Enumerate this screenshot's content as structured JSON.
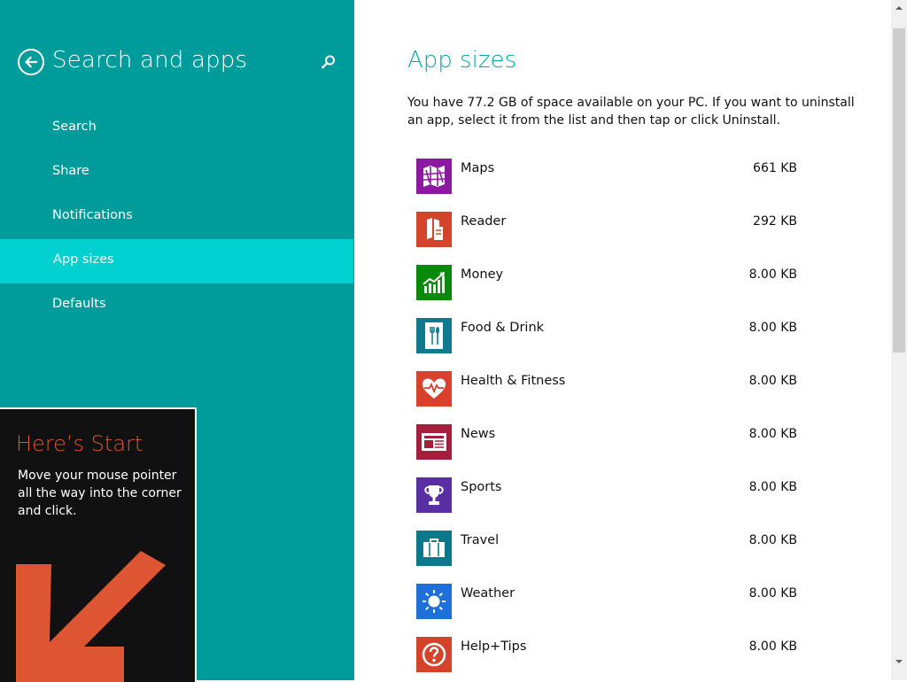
{
  "nav": {
    "title": "Search and apps",
    "back_icon": "back-arrow-icon",
    "search_icon": "search-icon",
    "items": [
      {
        "label": "Search",
        "active": false
      },
      {
        "label": "Share",
        "active": false
      },
      {
        "label": "Notifications",
        "active": false
      },
      {
        "label": "App sizes",
        "active": true
      },
      {
        "label": "Defaults",
        "active": false
      }
    ]
  },
  "start_tip": {
    "title": "Here’s Start",
    "body": "Move your mouse pointer all the way into the corner and click.",
    "icon": "corner-arrow-icon"
  },
  "main": {
    "title": "App sizes",
    "description": "You have 77.2 GB of space available on your PC. If you want to uninstall an app, select it from the list and then tap or click Uninstall.",
    "apps": [
      {
        "name": "Maps",
        "size": "661 KB",
        "icon": "maps-icon",
        "color": "#8c1aa0"
      },
      {
        "name": "Reader",
        "size": "292 KB",
        "icon": "reader-icon",
        "color": "#d4442a"
      },
      {
        "name": "Money",
        "size": "8.00 KB",
        "icon": "money-icon",
        "color": "#0a8a0a"
      },
      {
        "name": "Food & Drink",
        "size": "8.00 KB",
        "icon": "food-drink-icon",
        "color": "#0e7a8c"
      },
      {
        "name": "Health & Fitness",
        "size": "8.00 KB",
        "icon": "health-fitness-icon",
        "color": "#d9412c"
      },
      {
        "name": "News",
        "size": "8.00 KB",
        "icon": "news-icon",
        "color": "#a51e3c"
      },
      {
        "name": "Sports",
        "size": "8.00 KB",
        "icon": "sports-icon",
        "color": "#5a2fa3"
      },
      {
        "name": "Travel",
        "size": "8.00 KB",
        "icon": "travel-icon",
        "color": "#0a7a8a"
      },
      {
        "name": "Weather",
        "size": "8.00 KB",
        "icon": "weather-icon",
        "color": "#1e6fd9"
      },
      {
        "name": "Help+Tips",
        "size": "8.00 KB",
        "icon": "help-tips-icon",
        "color": "#d4442a"
      }
    ]
  },
  "colors": {
    "nav_background": "#009b9b",
    "nav_active": "#00d0d0",
    "title_accent": "#00aaaa",
    "tip_title": "#dd5533",
    "tip_arrow": "#dd5533"
  }
}
